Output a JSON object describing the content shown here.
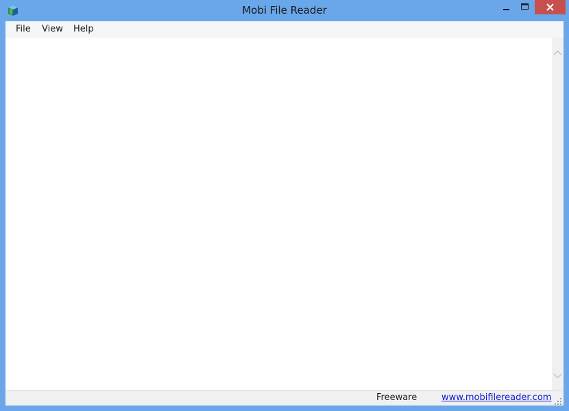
{
  "window": {
    "title": "Mobi File Reader",
    "icon": "book-icon",
    "controls": [
      "minimize-icon",
      "maximize-icon",
      "close-icon"
    ]
  },
  "menu": {
    "items": [
      {
        "label": "File"
      },
      {
        "label": "View"
      },
      {
        "label": "Help"
      }
    ]
  },
  "statusbar": {
    "text": "Freeware",
    "link": "www.mobifilereader.com"
  },
  "colors": {
    "frame": "#6aa7ea",
    "close_button": "#c7504f",
    "link": "#0b18d6"
  }
}
